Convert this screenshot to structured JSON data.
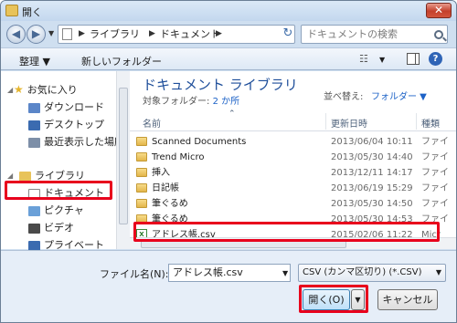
{
  "window": {
    "title": "開く",
    "close_label": "✕"
  },
  "nav": {
    "breadcrumbs": [
      "ライブラリ",
      "ドキュメント"
    ],
    "search_placeholder": "ドキュメントの検索"
  },
  "toolbar": {
    "organize": "整理 ▼",
    "new_folder": "新しいフォルダー"
  },
  "sidebar": {
    "favorites": "お気に入り",
    "downloads": "ダウンロード",
    "desktop": "デスクトップ",
    "recent": "最近表示した場所",
    "libraries": "ライブラリ",
    "documents": "ドキュメント",
    "pictures": "ピクチャ",
    "videos": "ビデオ",
    "private": "プライベート"
  },
  "main": {
    "library_title": "ドキュメント ライブラリ",
    "target_label": "対象フォルダー: ",
    "target_value": "2 か所",
    "arrange_label": "並べ替え:",
    "arrange_value": "フォルダー ▼",
    "columns": {
      "name": "名前",
      "date": "更新日時",
      "type": "種類"
    },
    "files": [
      {
        "name": "Scanned Documents",
        "date": "2013/06/04 10:11",
        "type": "ファイ"
      },
      {
        "name": "Trend Micro",
        "date": "2013/05/30 14:40",
        "type": "ファイ"
      },
      {
        "name": "挿入",
        "date": "2013/12/11 14:17",
        "type": "ファイ"
      },
      {
        "name": "日記帳",
        "date": "2013/06/19 15:29",
        "type": "ファイ"
      },
      {
        "name": "筆ぐるめ",
        "date": "2013/05/30 14:50",
        "type": "ファイ"
      },
      {
        "name": "筆ぐるめ",
        "date": "2013/05/30 14:53",
        "type": "ファイ"
      },
      {
        "name": "アドレス帳.csv",
        "date": "2015/02/06 11:22",
        "type": "Micr"
      }
    ]
  },
  "bottom": {
    "filename_label": "ファイル名(N):",
    "filename_value": "アドレス帳.csv",
    "filetype_value": "CSV (カンマ区切り) (*.CSV)",
    "open_button": "開く(O)",
    "cancel_button": "キャンセル"
  },
  "colors": {
    "highlight": "#e8001c",
    "accent": "#1e4e9a"
  }
}
